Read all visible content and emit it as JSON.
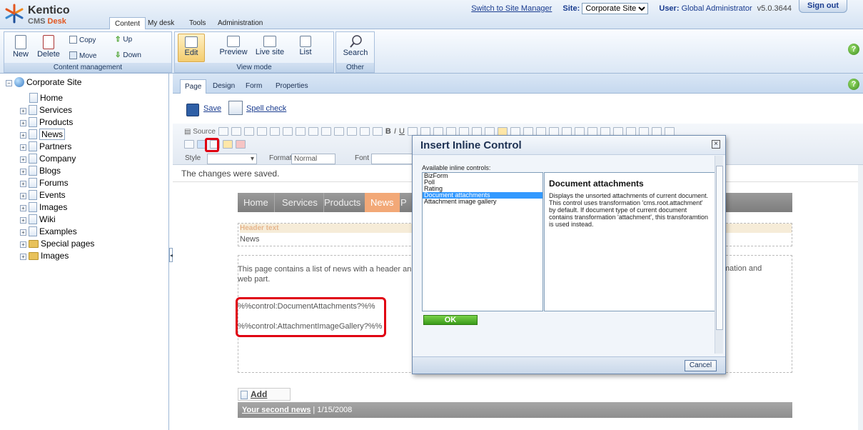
{
  "header": {
    "logo_title": "Kentico",
    "logo_cms": "CMS",
    "logo_desk": "Desk",
    "tabs": [
      {
        "label": "Content"
      },
      {
        "label": "My desk"
      },
      {
        "label": "Tools"
      },
      {
        "label": "Administration"
      }
    ],
    "switch_link": "Switch to Site Manager",
    "site_label": "Site:",
    "site_value": "Corporate Site",
    "user_label": "User:",
    "user_value": "Global Administrator",
    "version": "v5.0.3644",
    "sign_out": "Sign out"
  },
  "ribbon": {
    "content_management": {
      "title": "Content management",
      "new": "New",
      "delete": "Delete",
      "copy": "Copy",
      "move": "Move",
      "up": "Up",
      "down": "Down"
    },
    "view_mode": {
      "title": "View mode",
      "edit": "Edit",
      "preview": "Preview",
      "live_site": "Live site",
      "list": "List"
    },
    "other": {
      "title": "Other",
      "search": "Search"
    }
  },
  "tree": {
    "root": "Corporate Site",
    "items": [
      {
        "label": "Home"
      },
      {
        "label": "Services"
      },
      {
        "label": "Products"
      },
      {
        "label": "News"
      },
      {
        "label": "Partners"
      },
      {
        "label": "Company"
      },
      {
        "label": "Blogs"
      },
      {
        "label": "Forums"
      },
      {
        "label": "Events"
      },
      {
        "label": "Images"
      },
      {
        "label": "Wiki"
      },
      {
        "label": "Examples"
      },
      {
        "label": "Special pages"
      },
      {
        "label": "Images"
      }
    ]
  },
  "subtabs": [
    {
      "label": "Page"
    },
    {
      "label": "Design"
    },
    {
      "label": "Form"
    },
    {
      "label": "Properties"
    }
  ],
  "actions": {
    "save": "Save",
    "spell_check": "Spell check"
  },
  "toolbar": {
    "source": "Source",
    "style_label": "Style",
    "format_label": "Format",
    "format_value": "Normal",
    "font_label": "Font"
  },
  "status_message": "The changes were saved.",
  "preview": {
    "menu": [
      {
        "label": "Home"
      },
      {
        "label": "Services"
      },
      {
        "label": "Products"
      },
      {
        "label": "News"
      },
      {
        "label": "P"
      }
    ],
    "header_text_label": "Header text",
    "header_text_value": "News",
    "body_line1": "This page contains a list of news with a header an",
    "body_line2": "web part.",
    "body_right": "formation and",
    "macro1": "%%control:DocumentAttachments?%%",
    "macro2": "%%control:AttachmentImageGallery?%%",
    "add_news": "Add news",
    "news_title": "Your second news",
    "news_date": "1/15/2008"
  },
  "dialog": {
    "title": "Insert Inline Control",
    "available_label": "Available inline controls:",
    "controls": [
      {
        "label": "BizForm"
      },
      {
        "label": "Poll"
      },
      {
        "label": "Rating"
      },
      {
        "label": "Document attachments"
      },
      {
        "label": "Attachment image gallery"
      }
    ],
    "selected": "Document attachments",
    "description_title": "Document attachments",
    "description": "Displays the unsorted attachments of current document. This control uses transformation 'cms.root.attachment' by default. If document type of current document contains transformation 'attachment', this transforamtion is used instead.",
    "ok": "OK",
    "cancel": "Cancel"
  },
  "colors": {
    "highlight_red": "#e00012",
    "selection_blue": "#3399ff",
    "ok_green": "#3a9a1a",
    "menu_active": "#f2a877"
  },
  "help_icon": "?"
}
